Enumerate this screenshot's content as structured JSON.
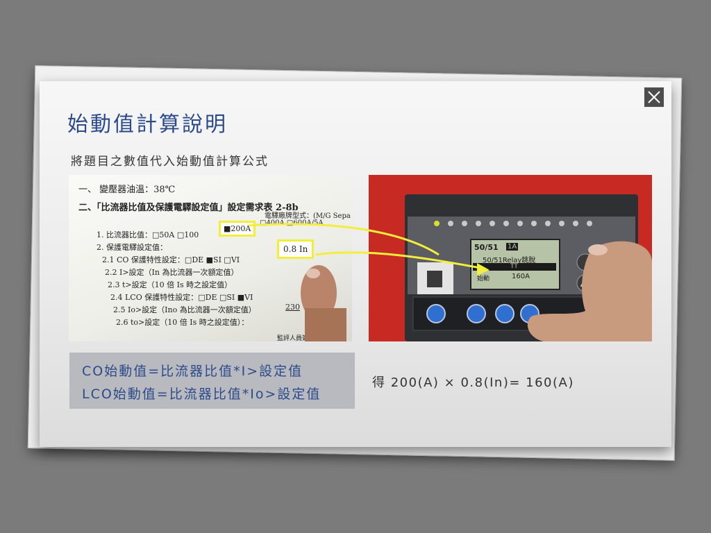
{
  "slide": {
    "title": "始動值計算說明",
    "subtitle": "將題目之數值代入始動值計算公式",
    "close_label": "×"
  },
  "document_photo": {
    "line1": "一、 變壓器油溫：38℃",
    "line2": "二、「比流器比值及保護電驛設定值」設定需求表 2-8b",
    "line3": "電驛廠牌型式：(M/G Sepa",
    "line4a": "1. 比流器比值：□50A □100",
    "highlight_ct": "■200A",
    "line4b": "□400A □600A/5A",
    "line5": "2. 保護電驛設定值：",
    "line6": "2.1  CO 保護特性設定：□DE ■SI □VI",
    "line7": "2.2  I>設定（In 為比流器一次額定值）",
    "highlight_setting": "0.8  In",
    "line8": "2.3  t>設定（10 倍 Is 時之設定值）",
    "line9": "2.4  LCO 保護特性設定：□DE □SI ■VI",
    "line10": "2.5  Io>設定（Ino 為比流器一次額定值）",
    "line10v": "230",
    "line11": "2.6  to>設定（10 倍 Is 時之設定值）：",
    "line12": "監評人員簽名："
  },
  "relay_photo": {
    "tag": "50/51",
    "tag_box": "1A",
    "menu_title": "50/51Relay跳脫",
    "menu_row": "TT",
    "value_label": "始動",
    "value": "160A"
  },
  "formulas": {
    "co": "CO始動值=比流器比值*I>設定值",
    "lco": "LCO始動值=比流器比值*Io>設定值"
  },
  "result": "得 200(A) × 0.8(In)= 160(A)",
  "colors": {
    "title": "#2b4a8a",
    "highlight": "#f2ee3a",
    "formula_bg": "#b9babf"
  }
}
